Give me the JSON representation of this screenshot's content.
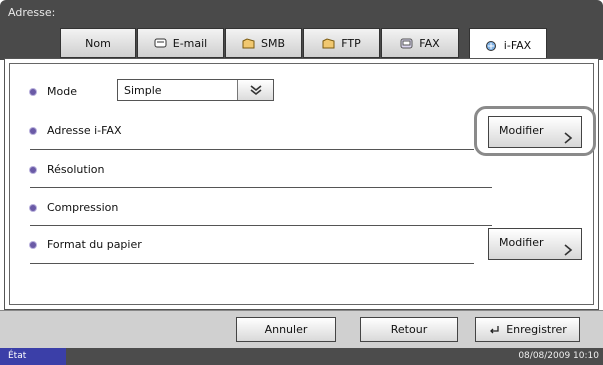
{
  "header": {
    "title": "Adresse:"
  },
  "tabs": [
    {
      "label": "Nom",
      "icon": ""
    },
    {
      "label": "E-mail",
      "icon": "email-icon"
    },
    {
      "label": "SMB",
      "icon": "folder-icon"
    },
    {
      "label": "FTP",
      "icon": "folder-icon"
    },
    {
      "label": "FAX",
      "icon": "fax-icon"
    },
    {
      "label": "i-FAX",
      "icon": "ifax-icon",
      "active": true
    }
  ],
  "form": {
    "mode_label": "Mode",
    "mode_value": "Simple",
    "adresse_ifax_label": "Adresse i-FAX",
    "resolution_label": "Résolution",
    "compression_label": "Compression",
    "format_label": "Format du papier",
    "modifier_label": "Modifier"
  },
  "footer": {
    "cancel_label": "Annuler",
    "back_label": "Retour",
    "save_label": "Enregistrer"
  },
  "status": {
    "state": "État",
    "datetime": "08/08/2009   10:10"
  },
  "colors": {
    "header_bg": "#4a4a4a",
    "bullet": "#6a5aa6",
    "status_state_bg": "#3b3fa8"
  }
}
